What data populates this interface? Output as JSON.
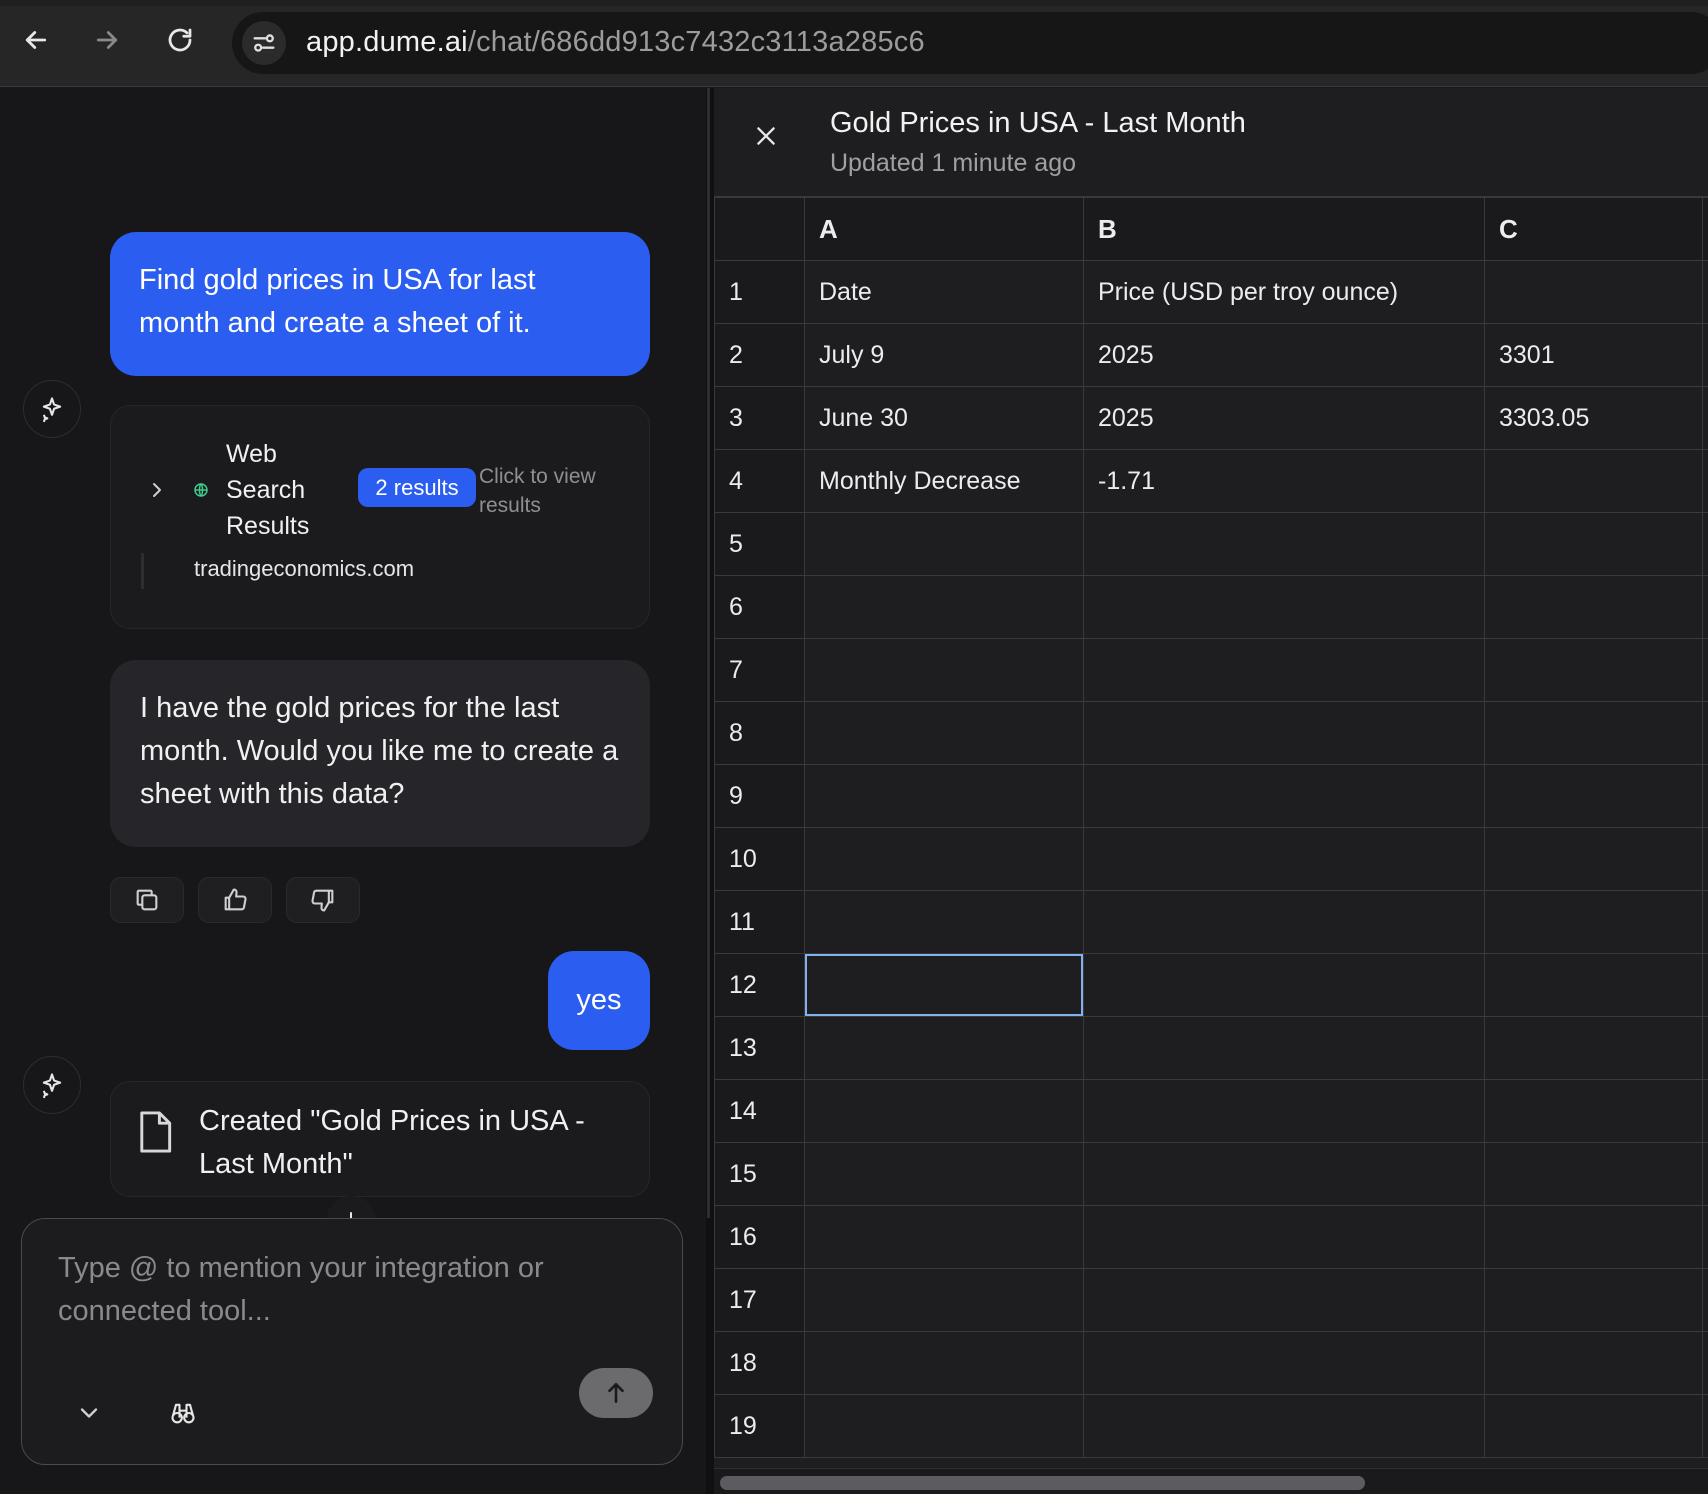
{
  "browser": {
    "url_host": "app.dume.ai",
    "url_path": "/chat/686dd913c7432c3113a285c6"
  },
  "chat": {
    "messages": {
      "user_1": "Find gold prices in USA for last month and create a sheet of it.",
      "ai_1": "I have the gold prices for the last month. Would you like me to create a sheet with this data?",
      "user_2": "yes",
      "created": "Created \"Gold Prices in USA - Last Month\""
    },
    "tool_card": {
      "title": "Web Search Results",
      "badge": "2 results",
      "hint": "Click to view results",
      "source": "tradingeconomics.com"
    },
    "composer": {
      "placeholder": "Type @ to mention your integration or connected tool..."
    }
  },
  "sheet": {
    "title": "Gold Prices in USA - Last Month",
    "subtitle": "Updated 1 minute ago",
    "columns": [
      "A",
      "B",
      "C"
    ],
    "rows": [
      {
        "n": "1",
        "a": "Date",
        "b": "Price (USD per troy ounce)",
        "c": ""
      },
      {
        "n": "2",
        "a": "July 9",
        "b": "2025",
        "c": "3301"
      },
      {
        "n": "3",
        "a": "June 30",
        "b": "2025",
        "c": "3303.05"
      },
      {
        "n": "4",
        "a": "Monthly Decrease",
        "b": "-1.71",
        "c": ""
      },
      {
        "n": "5",
        "a": "",
        "b": "",
        "c": ""
      },
      {
        "n": "6",
        "a": "",
        "b": "",
        "c": ""
      },
      {
        "n": "7",
        "a": "",
        "b": "",
        "c": ""
      },
      {
        "n": "8",
        "a": "",
        "b": "",
        "c": ""
      },
      {
        "n": "9",
        "a": "",
        "b": "",
        "c": ""
      },
      {
        "n": "10",
        "a": "",
        "b": "",
        "c": ""
      },
      {
        "n": "11",
        "a": "",
        "b": "",
        "c": ""
      },
      {
        "n": "12",
        "a": "",
        "b": "",
        "c": ""
      },
      {
        "n": "13",
        "a": "",
        "b": "",
        "c": ""
      },
      {
        "n": "14",
        "a": "",
        "b": "",
        "c": ""
      },
      {
        "n": "15",
        "a": "",
        "b": "",
        "c": ""
      },
      {
        "n": "16",
        "a": "",
        "b": "",
        "c": ""
      },
      {
        "n": "17",
        "a": "",
        "b": "",
        "c": ""
      },
      {
        "n": "18",
        "a": "",
        "b": "",
        "c": ""
      },
      {
        "n": "19",
        "a": "",
        "b": "",
        "c": ""
      }
    ],
    "selected_cell": "A12"
  },
  "colors": {
    "accent": "#2b5ef0",
    "selection": "#7fb3ef",
    "globe": "#3ecf8e"
  },
  "icons": [
    "back-arrow-icon",
    "forward-arrow-icon",
    "reload-icon",
    "site-settings-icon",
    "sparkle-icon",
    "chevron-right-icon",
    "globe-icon",
    "copy-icon",
    "thumbs-up-icon",
    "thumbs-down-icon",
    "document-icon",
    "arrow-down-icon",
    "chevron-down-icon",
    "binoculars-icon",
    "send-arrow-icon",
    "close-icon"
  ]
}
